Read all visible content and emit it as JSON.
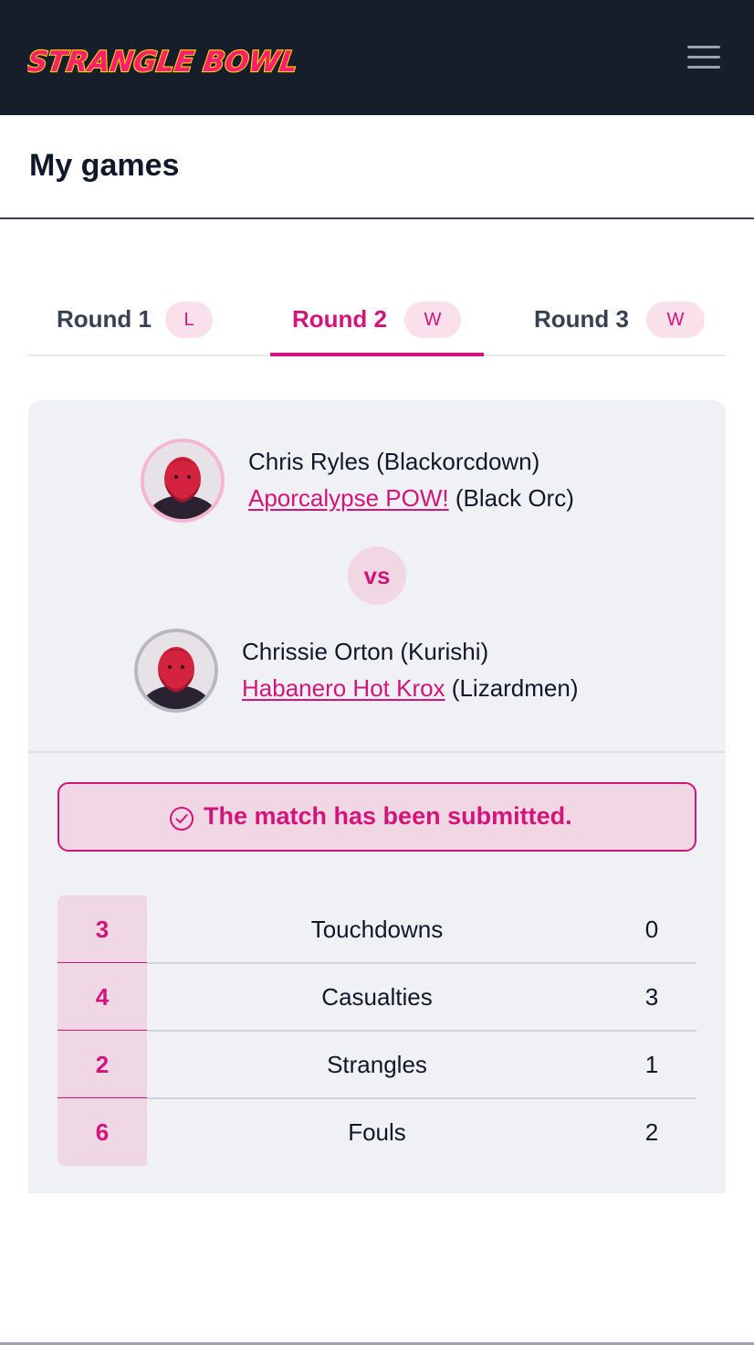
{
  "app": {
    "logo_text": "STRANGLE BOWL"
  },
  "header": {
    "menu_icon": "hamburger-menu-icon"
  },
  "page": {
    "title": "My games"
  },
  "tabs": [
    {
      "label": "Round 1",
      "badge": "L",
      "active": false
    },
    {
      "label": "Round 2",
      "badge": "W",
      "active": true
    },
    {
      "label": "Round 3",
      "badge": "W",
      "active": false
    }
  ],
  "match": {
    "home": {
      "player": "Chris Ryles (Blackorcdown)",
      "team": "Aporcalypse POW!",
      "race": "(Black Orc)"
    },
    "vs_label": "vs",
    "away": {
      "player": "Chrissie Orton (Kurishi)",
      "team": "Habanero Hot Krox",
      "race": "(Lizardmen)"
    },
    "status_text": "The match has been submitted.",
    "status_icon": "check-circle-icon"
  },
  "stats": [
    {
      "label": "Touchdowns",
      "home": "3",
      "away": "0"
    },
    {
      "label": "Casualties",
      "home": "4",
      "away": "3"
    },
    {
      "label": "Strangles",
      "home": "2",
      "away": "1"
    },
    {
      "label": "Fouls",
      "home": "6",
      "away": "2"
    }
  ],
  "colors": {
    "accent": "#d1157a",
    "logo": "#ff1f6b",
    "navbar": "#171e2b",
    "card": "#eff1f5"
  }
}
